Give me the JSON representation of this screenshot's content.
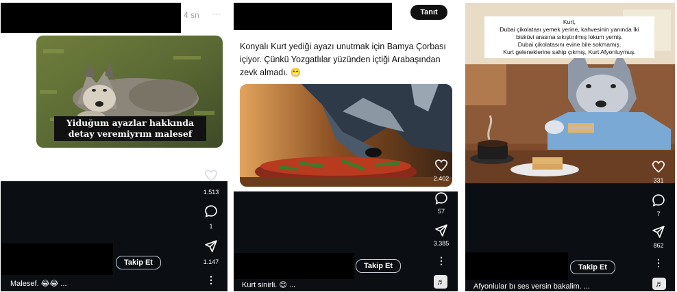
{
  "panel1": {
    "time": "4 sn",
    "more": "···",
    "meme_line1": "Yiduğum ayazlar hakkında",
    "meme_line2": "detay veremiyrım malesef",
    "like_count": "1.513",
    "comment_count": "1",
    "share_count": "1.147",
    "follow_label": "Takip Et",
    "caption": "Malesef.",
    "caption_emoji": "😂😂",
    "caption_more": "..."
  },
  "panel2": {
    "intro_label": "Tanıt",
    "post_text": "Konyalı Kurt yediği ayazı unutmak için Bamya Çorbası içiyor. Çünkü Yozgatlılar yüzünden içtiği Arabaşından zevk almadı. 😁",
    "like_count": "2.402",
    "comment_count": "57",
    "share_count": "3.385",
    "follow_label": "Takip Et",
    "caption": "Kurt sinirli.",
    "caption_emoji": "😊",
    "caption_more": "..."
  },
  "panel3": {
    "header_lines": [
      "Kurt,",
      "Dubai çikolatası yemek yerine, kahvesinin yanında İki",
      "bisküvi arasına sıkıştırılmış lokum yemiş.",
      "Dubai çikolatasını evine bile sokmamış.",
      "Kurt geleneklerine sahip çıkmış, Kurt Afyonluymuş."
    ],
    "like_count": "331",
    "comment_count": "7",
    "share_count": "862",
    "follow_label": "Takip Et",
    "caption": "Afyonlular bı ses versin bakalim.",
    "caption_more": "..."
  },
  "icons": [
    "heart-icon",
    "comment-icon",
    "share-icon",
    "more-icon",
    "music-icon"
  ],
  "colors": {
    "dark_bg": "#0b0e13",
    "badge_bg": "#111111",
    "text_dark": "#111111"
  }
}
